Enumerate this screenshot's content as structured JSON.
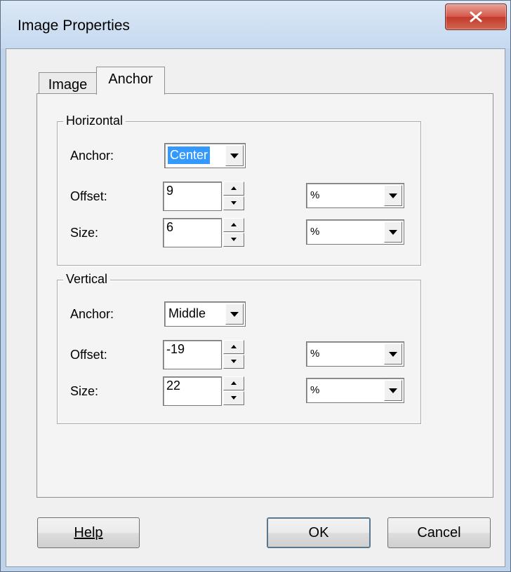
{
  "window": {
    "title": "Image Properties",
    "close_glyph": "x"
  },
  "tabs": [
    {
      "label": "Image",
      "active": false
    },
    {
      "label": "Anchor",
      "active": true
    }
  ],
  "horizontal": {
    "legend": "Horizontal",
    "anchor_label": "Anchor:",
    "anchor_value": "Center",
    "offset_label": "Offset:",
    "offset_value": "9",
    "offset_unit": "%",
    "size_label": "Size:",
    "size_value": "6",
    "size_unit": "%"
  },
  "vertical": {
    "legend": "Vertical",
    "anchor_label": "Anchor:",
    "anchor_value": "Middle",
    "offset_label": "Offset:",
    "offset_value": "-19",
    "offset_unit": "%",
    "size_label": "Size:",
    "size_value": "22",
    "size_unit": "%"
  },
  "buttons": {
    "help_label": "Help",
    "ok_label": "OK",
    "cancel_label": "Cancel"
  },
  "colors": {
    "selection": "#3399ff",
    "close_button": "#c84a3c"
  }
}
